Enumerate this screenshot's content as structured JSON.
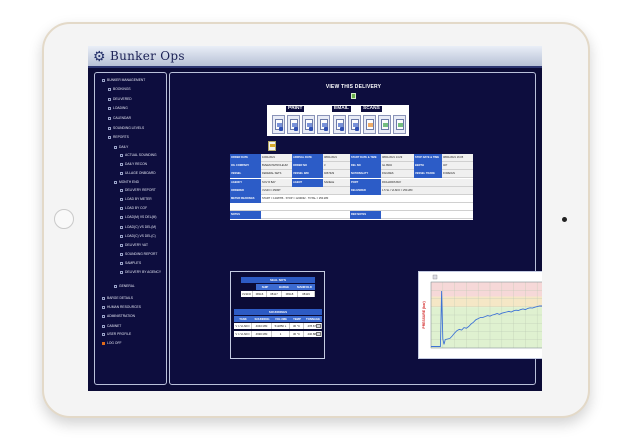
{
  "app": {
    "logo_text": "Bunker Ops",
    "logo_icon": "gear-icon"
  },
  "sidebar": {
    "items": [
      {
        "label": "BUNKER MANAGEMENT",
        "level": 0
      },
      {
        "label": "BOOKINGS",
        "level": 1
      },
      {
        "label": "DELIVERED",
        "level": 1
      },
      {
        "label": "LOADING",
        "level": 1
      },
      {
        "label": "CALENDAR",
        "level": 1
      },
      {
        "label": "SOUNDING LEVELS",
        "level": 1
      },
      {
        "label": "REPORTS",
        "level": 1
      },
      {
        "label": "DAILY",
        "level": 2
      },
      {
        "label": "ACTUAL SOUNDING",
        "level": 3
      },
      {
        "label": "DAILY RECON",
        "level": 3
      },
      {
        "label": "ULLAGE ONBOARD",
        "level": 3
      },
      {
        "label": "MONTH END",
        "level": 2
      },
      {
        "label": "DELIVERY REPORT",
        "level": 3
      },
      {
        "label": "LOAD BY METER",
        "level": 3
      },
      {
        "label": "LOAD BY COF",
        "level": 3
      },
      {
        "label": "LOAD(M) VS DEL(M)",
        "level": 3
      },
      {
        "label": "LOAD(C) VS DEL(M)",
        "level": 3
      },
      {
        "label": "LOAD(C) VS DEL(C)",
        "level": 3
      },
      {
        "label": "DELIVERY VAT",
        "level": 3
      },
      {
        "label": "SOUNDING REPORT",
        "level": 3
      },
      {
        "label": "SAMPLE'S",
        "level": 3
      },
      {
        "label": "DELIVERY BY AGENCY",
        "level": 3
      },
      {
        "label": "GENERAL",
        "level": 2
      },
      {
        "label": "BARGE DETAILS",
        "level": 0
      },
      {
        "label": "HUMAN RESOURCES",
        "level": 0
      },
      {
        "label": "ADMINISTRATION",
        "level": 0
      },
      {
        "label": "CABINET",
        "level": 0
      },
      {
        "label": "USER PROFILE",
        "level": 0
      },
      {
        "label": "LOG OFF",
        "level": 0
      }
    ]
  },
  "main": {
    "title": "VIEW THIS DELIVERY",
    "tools": {
      "print_label": "PRINT",
      "email_label": "EMAIL",
      "scans_label": "SCANS"
    },
    "details": {
      "rows": [
        [
          {
            "t": "ORDER DATE",
            "k": "lbl"
          },
          {
            "t": "10/01/2021",
            "k": "val"
          },
          {
            "t": "ARRIVAL DATE",
            "k": "lbl"
          },
          {
            "t": "08/01/2021",
            "k": "val"
          },
          {
            "t": "START DATE & TIME",
            "k": "lbl"
          },
          {
            "t": "08/01/2021 14:29",
            "k": "val"
          },
          {
            "t": "STOP DATE & TIME",
            "k": "lbl"
          },
          {
            "t": "08/01/2021 16:05",
            "k": "val"
          }
        ],
        [
          {
            "t": "OIL COMPANY",
            "k": "lbl"
          },
          {
            "t": "BVEEN PETROLEUM",
            "k": "val"
          },
          {
            "t": "ORDER NO",
            "k": "lbl"
          },
          {
            "t": "3",
            "k": "val"
          },
          {
            "t": "DEL NO",
            "k": "lbl"
          },
          {
            "t": "GL 8904",
            "k": "val"
          },
          {
            "t": "BERTH",
            "k": "lbl"
          },
          {
            "t": "407",
            "k": "val"
          }
        ],
        [
          {
            "t": "VESSEL",
            "k": "lbl"
          },
          {
            "t": "FEDERAL SETS",
            "k": "val"
          },
          {
            "t": "VESSEL IMO",
            "k": "lbl"
          },
          {
            "t": "9267329",
            "k": "val"
          },
          {
            "t": "NATIONALITY",
            "k": "lbl"
          },
          {
            "t": "FIGURES",
            "k": "val"
          },
          {
            "t": "VESSEL TRADE",
            "k": "lbl"
          },
          {
            "t": "FOREIGN",
            "k": "val"
          }
        ],
        [
          {
            "t": "AGENCY",
            "k": "lbl"
          },
          {
            "t": "SOV R BAY",
            "k": "val"
          },
          {
            "t": "AGENT",
            "k": "lbl"
          },
          {
            "t": "SANELE",
            "k": "val"
          },
          {
            "t": "PORT",
            "k": "lbl"
          },
          {
            "t": "RICHARDS BAY",
            "k": "val"
          },
          {
            "t": "",
            "k": "val"
          },
          {
            "t": "",
            "k": "val"
          }
        ],
        [
          {
            "t": "ORDERED",
            "k": "lbl"
          },
          {
            "t": "VLSFO / 250MT",
            "k": "val"
          },
          {
            "t": "",
            "k": "val"
          },
          {
            "t": "",
            "k": "val"
          },
          {
            "t": "DELIVERED",
            "k": "lbl"
          },
          {
            "t": "1.5 SL / VLSFO = 250.280",
            "k": "val"
          },
          {
            "t": "",
            "k": "val"
          },
          {
            "t": "",
            "k": "val"
          }
        ],
        [
          {
            "t": "METER READINGS",
            "k": "lbl"
          },
          {
            "t": "START = 1248786 · STOP = 1249032 · TOTAL = 250.280",
            "k": "wide"
          }
        ],
        [
          {
            "t": "",
            "k": "wide"
          }
        ],
        [
          {
            "t": "NOTES",
            "k": "lbl"
          },
          {
            "t": "",
            "k": "wide"
          },
          {
            "t": "RER NOTES",
            "k": "lbl"
          },
          {
            "t": "",
            "k": "wide"
          }
        ]
      ]
    },
    "seal_nos": {
      "title": "SEAL NO'S",
      "columns": [
        "SHIP",
        "BARGE",
        "MANIFOLD"
      ],
      "row": [
        "VLSFO",
        "08116",
        "08117",
        "08118",
        "08119"
      ]
    },
    "soundings": {
      "title": "SOUNDINGS",
      "columns": [
        "TANK",
        "SOUNDING",
        "VOLUME",
        "TEMP",
        "TONNAGE"
      ],
      "rows": [
        [
          "V 1 VLSFO",
          "4040 MM",
          "512850 L",
          "30 °C",
          "478.671"
        ],
        [
          "V 1 VLSFO",
          "4690 MM",
          "1",
          "30 °C",
          "446.884"
        ]
      ]
    },
    "chart": {
      "ylabel": "PRESSURE (bar)"
    }
  },
  "chart_data": {
    "type": "line",
    "ylabel": "PRESSURE (bar)",
    "xlabel": "",
    "title": "",
    "grid": true,
    "series_color": "#3f73d6",
    "bands": [
      "#f6d8d8",
      "#f5e7c6",
      "#dff1d0"
    ],
    "x": [
      0,
      3,
      6,
      8,
      9,
      10,
      11,
      12,
      14,
      16,
      18,
      20,
      22,
      24,
      26,
      28,
      30,
      32,
      34,
      36,
      38,
      40,
      42,
      44,
      46,
      48,
      50,
      52,
      54,
      56,
      58,
      60,
      62,
      64,
      66,
      68,
      70,
      72,
      74,
      76,
      78,
      80,
      82,
      84,
      86,
      88,
      90,
      92,
      94,
      96,
      98,
      100
    ],
    "y": [
      0.05,
      0.05,
      0.05,
      0.05,
      1.9,
      0.3,
      0.12,
      0.28,
      0.3,
      0.32,
      0.4,
      0.5,
      0.58,
      0.62,
      0.6,
      0.68,
      0.66,
      0.72,
      0.8,
      0.86,
      0.94,
      0.98,
      1.02,
      1.02,
      1.05,
      1.08,
      1.06,
      1.1,
      1.12,
      1.15,
      1.12,
      1.16,
      1.18,
      1.2,
      1.22,
      1.2,
      1.24,
      1.26,
      1.25,
      1.28,
      1.3,
      1.28,
      1.32,
      1.34,
      1.33,
      1.36,
      1.38,
      1.4,
      1.4,
      1.42,
      1.45,
      1.1
    ],
    "xlim": [
      0,
      100
    ],
    "ylim": [
      0,
      2.2
    ]
  }
}
